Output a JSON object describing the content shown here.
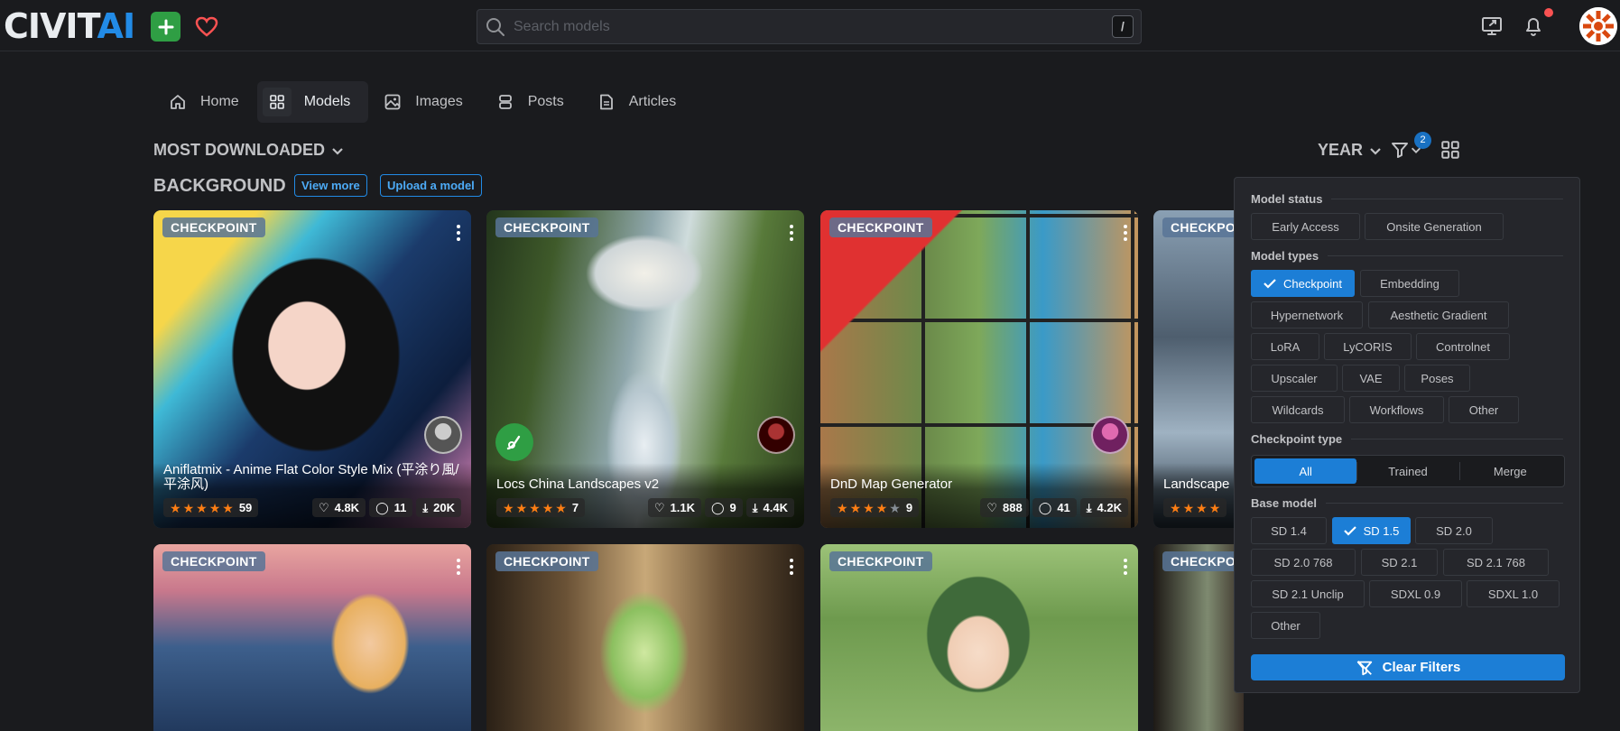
{
  "header": {
    "logo_part1": "CIVIT",
    "logo_part2": "AI",
    "search_placeholder": "Search models",
    "search_shortcut": "/"
  },
  "nav": {
    "tabs": [
      {
        "label": "Home",
        "icon": "home-icon"
      },
      {
        "label": "Models",
        "icon": "grid-icon",
        "active": true
      },
      {
        "label": "Images",
        "icon": "image-icon"
      },
      {
        "label": "Posts",
        "icon": "stack-icon"
      },
      {
        "label": "Articles",
        "icon": "file-icon"
      }
    ]
  },
  "toolbar": {
    "sort_label": "MOST DOWNLOADED",
    "period_label": "YEAR",
    "filter_count": "2"
  },
  "section": {
    "title": "BACKGROUND",
    "view_more": "View more",
    "upload": "Upload a model"
  },
  "cards": [
    {
      "type": "CHECKPOINT",
      "title": "Aniflatmix - Anime Flat Color Style Mix (平涂り風/平涂风)",
      "rating_count": "59",
      "stars": 5,
      "likes": "4.8K",
      "comments": "11",
      "downloads": "20K"
    },
    {
      "type": "CHECKPOINT",
      "title": "Locs China Landscapes v2",
      "rating_count": "7",
      "stars": 5,
      "likes": "1.1K",
      "comments": "9",
      "downloads": "4.4K"
    },
    {
      "type": "CHECKPOINT",
      "title": "DnD Map Generator",
      "rating_count": "9",
      "stars": 4,
      "likes": "888",
      "comments": "41",
      "downloads": "4.2K"
    },
    {
      "type": "CHECKPO",
      "title": "Landscape"
    },
    {
      "type": "CHECKPOINT"
    },
    {
      "type": "CHECKPOINT"
    },
    {
      "type": "CHECKPOINT"
    },
    {
      "type": "CHECKPO"
    }
  ],
  "filters": {
    "model_status_label": "Model status",
    "model_status": [
      "Early Access",
      "Onsite Generation"
    ],
    "model_types_label": "Model types",
    "model_types": [
      "Checkpoint",
      "Embedding",
      "Hypernetwork",
      "Aesthetic Gradient",
      "LoRA",
      "LyCORIS",
      "Controlnet",
      "Upscaler",
      "VAE",
      "Poses",
      "Wildcards",
      "Workflows",
      "Other"
    ],
    "checkpoint_type_label": "Checkpoint type",
    "checkpoint_types": [
      "All",
      "Trained",
      "Merge"
    ],
    "base_model_label": "Base model",
    "base_models": [
      "SD 1.4",
      "SD 1.5",
      "SD 2.0",
      "SD 2.0 768",
      "SD 2.1",
      "SD 2.1 768",
      "SD 2.1 Unclip",
      "SDXL 0.9",
      "SDXL 1.0",
      "Other"
    ],
    "clear_label": "Clear Filters"
  },
  "colors": {
    "accent": "#1c7ed6",
    "star": "#fd7e14",
    "plus_button": "#2f9e44",
    "heart": "#fa5252"
  }
}
